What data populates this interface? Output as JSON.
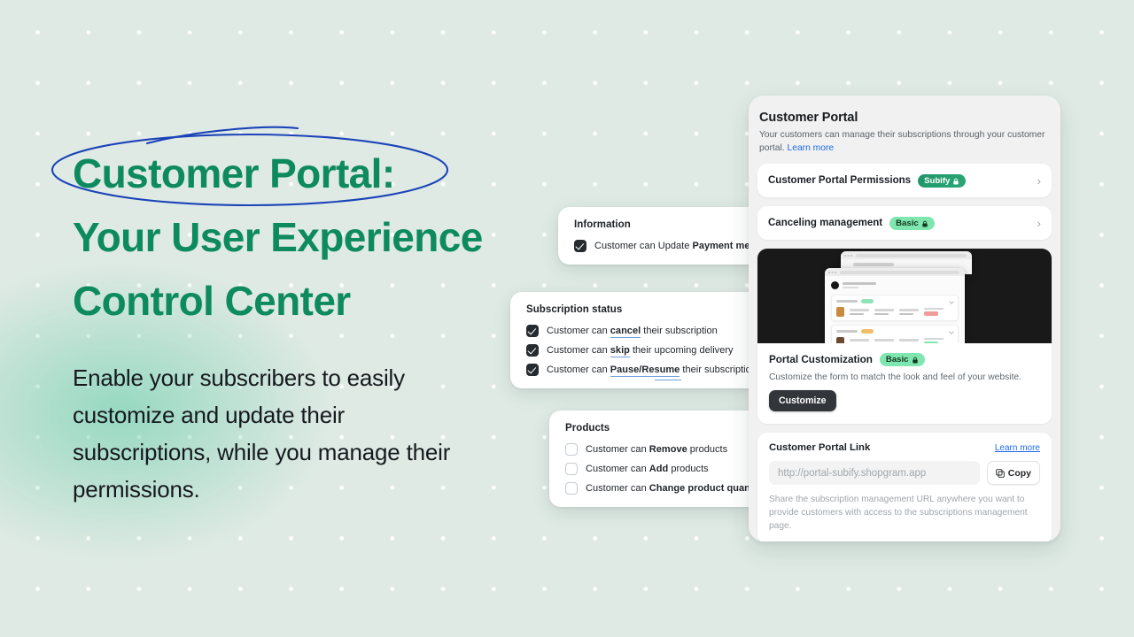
{
  "hero": {
    "headline_line1": "Customer Portal:",
    "headline_line2": "Your User Experience",
    "headline_line3": "Control Center",
    "body": "Enable your subscribers to easily customize and update their subscriptions, while you manage their permissions.",
    "headline_color": "#0e8a5f",
    "annotation_color": "#1b43b8"
  },
  "cards": {
    "information": {
      "title": "Information",
      "options": [
        {
          "checked": true,
          "prefix": "Customer can Update ",
          "bold": "Payment method",
          "suffix": "",
          "underline": false
        }
      ]
    },
    "subscription_status": {
      "title": "Subscription status",
      "options": [
        {
          "checked": true,
          "prefix": "Customer can ",
          "bold": "cancel",
          "suffix": " their subscription",
          "underline": true
        },
        {
          "checked": true,
          "prefix": "Customer can ",
          "bold": "skip",
          "suffix": " their upcoming delivery",
          "underline": true
        },
        {
          "checked": true,
          "prefix": "Customer can ",
          "bold": "Pause/Resume",
          "suffix": " their subscription renew",
          "underline": true
        }
      ]
    },
    "products": {
      "title": "Products",
      "options": [
        {
          "checked": false,
          "prefix": "Customer can ",
          "bold": "Remove",
          "suffix": " products",
          "underline": false
        },
        {
          "checked": false,
          "prefix": "Customer can ",
          "bold": "Add",
          "suffix": " products",
          "underline": false
        },
        {
          "checked": false,
          "prefix": "Customer can ",
          "bold": "Change product quantity",
          "suffix": "",
          "underline": false
        }
      ]
    }
  },
  "panel": {
    "title": "Customer Portal",
    "subtitle_text": "Your customers can manage their subscriptions through your customer portal. ",
    "subtitle_link": "Learn more",
    "rows": [
      {
        "label": "Customer Portal Permissions",
        "badge": "Subify",
        "badge_style": "dark",
        "chevron": "›"
      },
      {
        "label": "Canceling management",
        "badge": "Basic",
        "badge_style": "light",
        "chevron": "›"
      }
    ],
    "customization": {
      "title": "Portal Customization",
      "badge": "Basic",
      "description": "Customize the form to match the look and feel of your website.",
      "button": "Customize"
    },
    "portal_link": {
      "title": "Customer Portal Link",
      "learn_more": "Learn more",
      "input_placeholder": "http://portal-subify.shopgram.app",
      "input_value": "",
      "copy_button": "Copy",
      "note": "Share the subscription management URL anywhere you want to provide customers with access to the subscriptions management page."
    }
  },
  "colors": {
    "background": "#dfeae5",
    "brand_green": "#0e8a5f",
    "accent_blue": "#1d6ae5",
    "badge_dark_green": "#1f9468",
    "badge_light_green": "#7ee6ae",
    "dark_button": "#323539"
  }
}
